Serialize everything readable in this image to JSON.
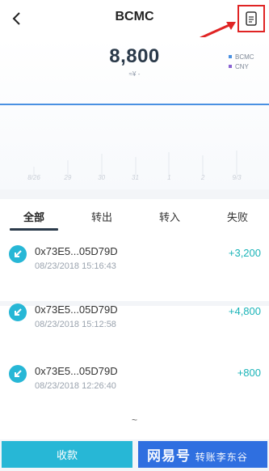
{
  "header": {
    "title": "BCMC",
    "back_icon": "chevron-left-icon",
    "record_icon": "document-icon",
    "annotation_color": "#e02424"
  },
  "balance": {
    "amount": "8,800",
    "fiat": "≈¥ -"
  },
  "legend": [
    {
      "label": "BCMC",
      "color": "#4a90e2"
    },
    {
      "label": "CNY",
      "color": "#8a63d2"
    }
  ],
  "chart_data": {
    "type": "line",
    "x": [
      "8/26",
      "29",
      "30",
      "31",
      "1",
      "2",
      "9/3"
    ],
    "series": [],
    "xlabel": "",
    "ylabel": "",
    "grid": false
  },
  "tabs": [
    {
      "label": "全部"
    },
    {
      "label": "转出"
    },
    {
      "label": "转入"
    },
    {
      "label": "失败"
    }
  ],
  "transactions": [
    {
      "address": "0x73E5...05D79D",
      "time": "08/23/2018 15:16:43",
      "amount": "+3,200"
    },
    {
      "address": "0x73E5...05D79D",
      "time": "08/23/2018 15:12:58",
      "amount": "+4,800"
    },
    {
      "address": "0x73E5...05D79D",
      "time": "08/23/2018 12:26:40",
      "amount": "+800"
    }
  ],
  "more_indicator": "~",
  "footer": {
    "receive_label": "收款",
    "transfer_label": "转账"
  },
  "watermark": {
    "text_big": "网易号",
    "text_small": "转账李东谷"
  },
  "colors": {
    "accent": "#27b7d6",
    "primary_blue": "#2f6fe0",
    "income": "#1ab4b8"
  }
}
